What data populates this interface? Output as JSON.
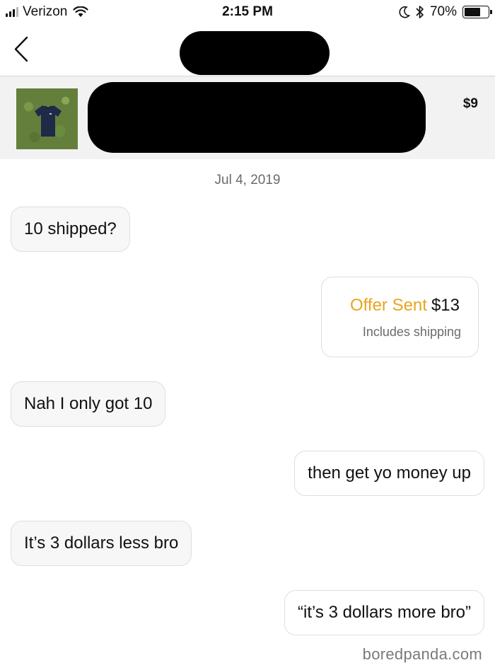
{
  "status_bar": {
    "carrier": "Verizon",
    "time": "2:15 PM",
    "battery_percent": "70%",
    "icons": [
      "signal-icon",
      "wifi-icon",
      "moon-icon",
      "bluetooth-icon",
      "battery-icon"
    ]
  },
  "nav": {
    "back_icon": "chevron-left-icon"
  },
  "item": {
    "price": "$9"
  },
  "conversation": {
    "date": "Jul 4, 2019",
    "messages": [
      {
        "text": "10 shipped?"
      },
      {
        "offer_label": "Offer Sent",
        "offer_amount": "$13",
        "offer_note": "Includes shipping"
      },
      {
        "text": "Nah I only got 10"
      },
      {
        "text": "then get yo money up"
      },
      {
        "text": "It’s 3 dollars less bro"
      },
      {
        "text": "“it’s 3 dollars more bro”"
      }
    ]
  },
  "watermark": "boredpanda.com",
  "colors": {
    "offer_accent": "#e8a51c",
    "bubble_bg": "#f7f7f7",
    "header_bg": "#f2f2f2"
  }
}
